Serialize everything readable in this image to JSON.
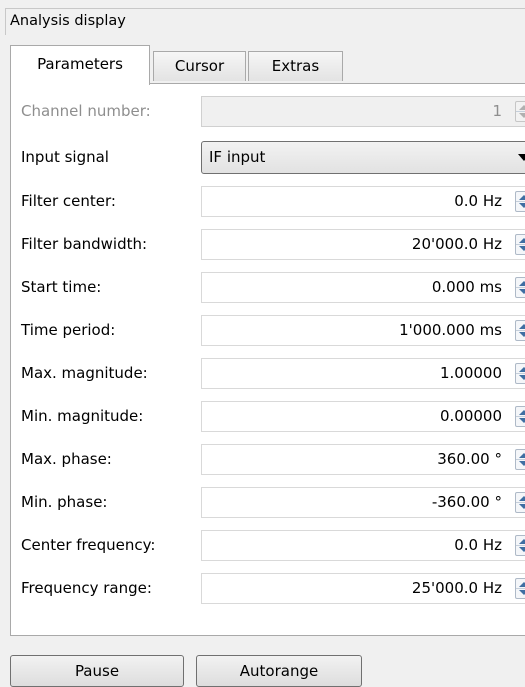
{
  "window": {
    "title": "Analysis display"
  },
  "tabs": [
    {
      "label": "Parameters",
      "active": true
    },
    {
      "label": "Cursor",
      "active": false
    },
    {
      "label": "Extras",
      "active": false
    }
  ],
  "fields": {
    "channel_number": {
      "label": "Channel number:",
      "value": "1",
      "disabled": true
    },
    "input_signal": {
      "label": "Input signal",
      "value": "IF input"
    },
    "filter_center": {
      "label": "Filter center:",
      "value": "0.0 Hz"
    },
    "filter_bandwidth": {
      "label": "Filter bandwidth:",
      "value": "20'000.0 Hz"
    },
    "start_time": {
      "label": "Start time:",
      "value": "0.000 ms"
    },
    "time_period": {
      "label": "Time period:",
      "value": "1'000.000 ms"
    },
    "max_magnitude": {
      "label": "Max. magnitude:",
      "value": "1.00000"
    },
    "min_magnitude": {
      "label": "Min. magnitude:",
      "value": "0.00000"
    },
    "max_phase": {
      "label": "Max. phase:",
      "value": "360.00 °"
    },
    "min_phase": {
      "label": "Min. phase:",
      "value": "-360.00 °"
    },
    "center_frequency": {
      "label": "Center frequency:",
      "value": "0.0 Hz"
    },
    "frequency_range": {
      "label": "Frequency range:",
      "value": "25'000.0 Hz"
    }
  },
  "buttons": {
    "pause": "Pause",
    "autorange": "Autorange"
  },
  "colors": {
    "panel": "#ffffff",
    "background": "#f0f0f0",
    "disabled_text": "#8e8e8e",
    "spin_arrow": "#3f6ea2"
  }
}
